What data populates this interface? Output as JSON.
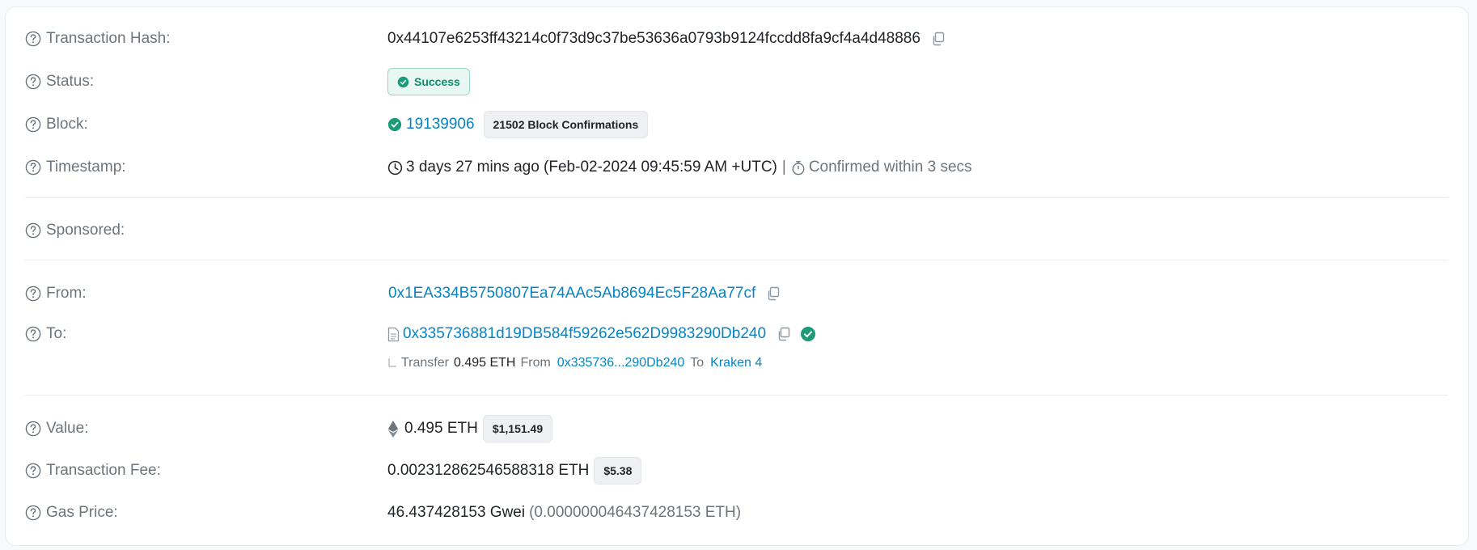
{
  "tx_hash": {
    "label": "Transaction Hash:",
    "value": "0x44107e6253ff43214c0f73d9c37be53636a0793b9124fccdd8fa9cf4a4d48886"
  },
  "status": {
    "label": "Status:",
    "value": "Success",
    "color": "#0b8f6d"
  },
  "block": {
    "label": "Block:",
    "number": "19139906",
    "confirmations": "21502 Block Confirmations"
  },
  "timestamp": {
    "label": "Timestamp:",
    "value": "3 days 27 mins ago (Feb-02-2024 09:45:59 AM +UTC)",
    "separator": "|",
    "confirmed": "Confirmed within 3 secs"
  },
  "sponsored": {
    "label": "Sponsored:"
  },
  "from": {
    "label": "From:",
    "address": "0x1EA334B5750807Ea74AAc5Ab8694Ec5F28Aa77cf"
  },
  "to": {
    "label": "To:",
    "address": "0x335736881d19DB584f59262e562D9983290Db240",
    "transfer": {
      "prefix": "Transfer",
      "amount": "0.495 ETH",
      "from_word": "From",
      "from_addr": "0x335736...290Db240",
      "to_word": "To",
      "to_name": "Kraken 4"
    }
  },
  "value": {
    "label": "Value:",
    "amount": "0.495 ETH",
    "usd": "$1,151.49"
  },
  "fee": {
    "label": "Transaction Fee:",
    "amount": "0.002312862546588318 ETH",
    "usd": "$5.38"
  },
  "gas": {
    "label": "Gas Price:",
    "gwei": "46.437428153 Gwei",
    "eth": "(0.000000046437428153 ETH)"
  },
  "colors": {
    "link": "#0784c3",
    "muted": "#6c757d",
    "success": "#0b8f6d"
  }
}
